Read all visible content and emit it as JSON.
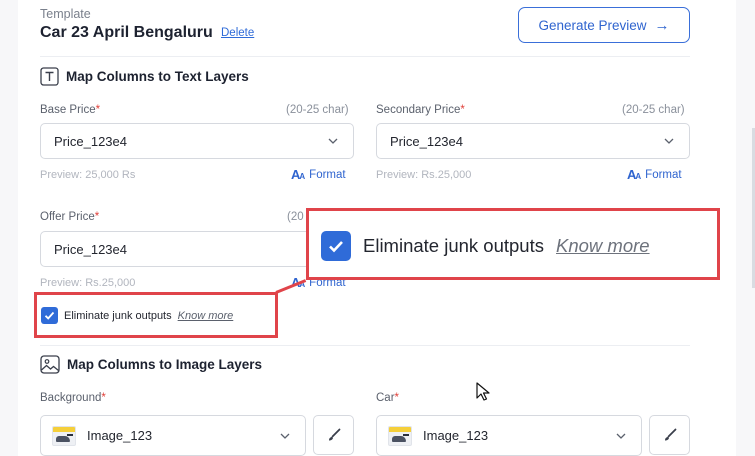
{
  "template": {
    "label": "Template",
    "name": "Car 23 April Bengaluru",
    "delete_label": "Delete"
  },
  "generate_button": {
    "label": "Generate Preview",
    "icon": "arrow-right-icon"
  },
  "text_layers": {
    "title": "Map Columns to Text Layers",
    "icon": "text-layer-icon",
    "fields": [
      {
        "label": "Base Price",
        "required_mark": "*",
        "hint": "(20-25 char)",
        "value": "Price_123e4",
        "preview": "Preview: 25,000 Rs",
        "format_label": "Format"
      },
      {
        "label": "Secondary Price",
        "required_mark": "*",
        "hint": "(20-25 char)",
        "value": "Price_123e4",
        "preview": "Preview: Rs.25,000",
        "format_label": "Format"
      },
      {
        "label": "Offer Price",
        "required_mark": "*",
        "hint": "(20",
        "value": "Price_123e4",
        "preview": "Preview: Rs.25,000",
        "format_label": "Format"
      }
    ]
  },
  "eliminate_junk": {
    "checked": true,
    "label": "Eliminate junk outputs",
    "link": "Know more"
  },
  "image_layers": {
    "title": "Map Columns to Image Layers",
    "icon": "image-layer-icon",
    "fields": [
      {
        "label": "Background",
        "required_mark": "*",
        "value": "Image_123"
      },
      {
        "label": "Car",
        "required_mark": "*",
        "value": "Image_123"
      }
    ]
  },
  "colors": {
    "accent": "#2f6bd8",
    "highlight": "#e0444a",
    "required": "#e0403a"
  }
}
